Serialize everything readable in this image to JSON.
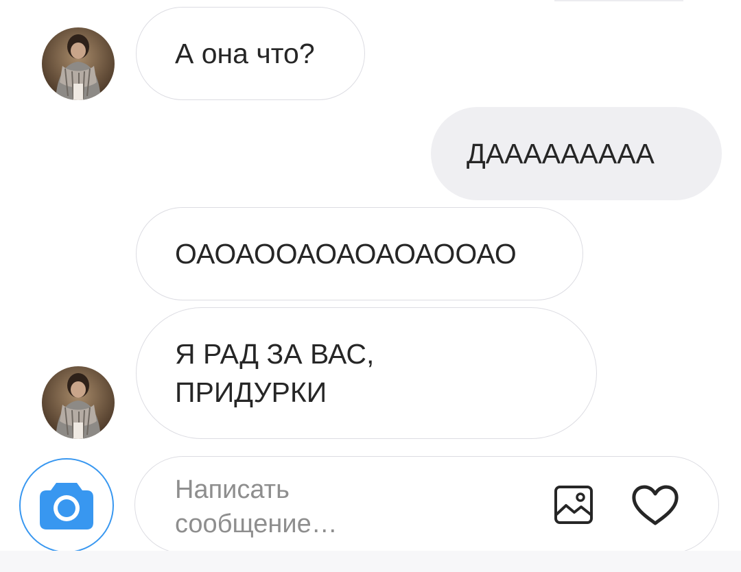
{
  "conversation": {
    "messages": [
      {
        "direction": "incoming",
        "text": "А она что?"
      },
      {
        "direction": "outgoing",
        "text": "ДААААААААА"
      },
      {
        "direction": "incoming",
        "text": "ОАОАООАОАОАОАООАО"
      },
      {
        "direction": "incoming",
        "line1": "Я РАД ЗА ВАС,",
        "line2": "ПРИДУРКИ"
      }
    ]
  },
  "composer": {
    "placeholder_line1": "Написать",
    "placeholder_line2": "сообщение…",
    "icons": {
      "camera": "camera-icon",
      "gallery": "image-icon",
      "like": "heart-icon"
    }
  },
  "colors": {
    "accent": "#3897f0",
    "outgoing_bubble": "#efeff2",
    "text": "#262626",
    "placeholder": "#8e8e8e",
    "border": "#dcdce2"
  }
}
